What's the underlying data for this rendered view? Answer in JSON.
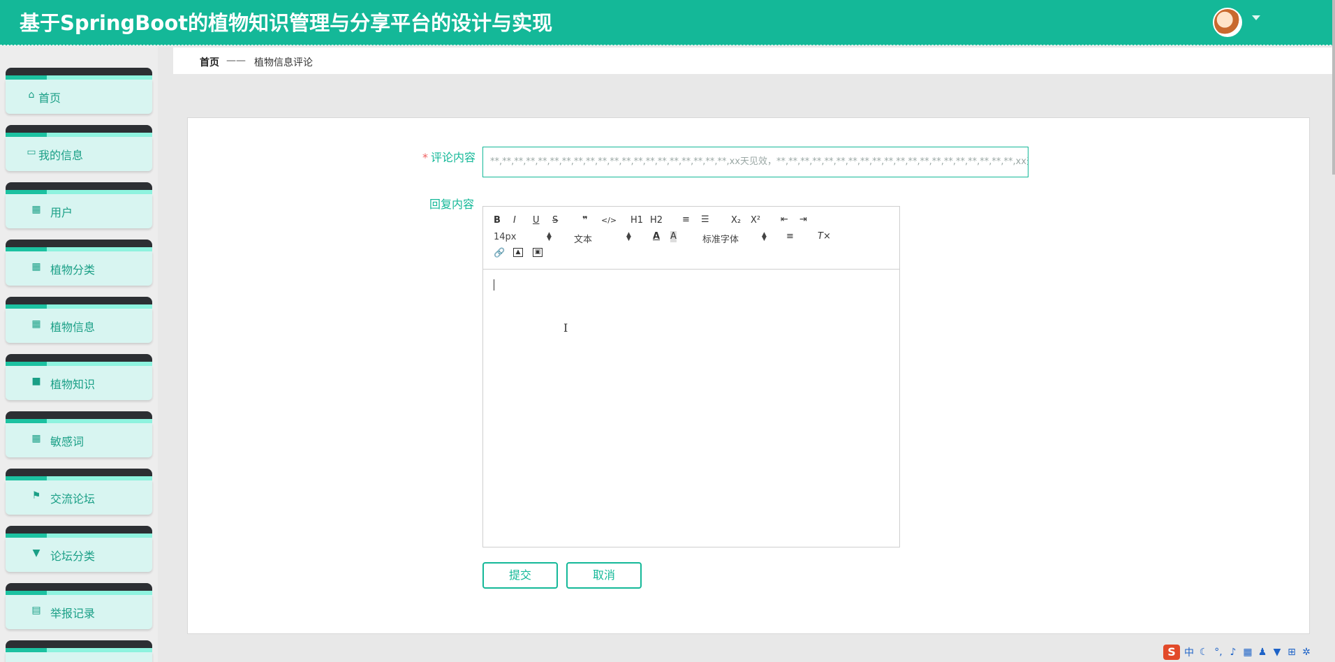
{
  "app": {
    "title": "基于SpringBoot的植物知识管理与分享平台的设计与实现"
  },
  "sidebar": {
    "items": [
      {
        "label": "首页",
        "icon": "home-icon",
        "glyph": "⌂"
      },
      {
        "label": "我的信息",
        "icon": "card-icon",
        "glyph": "▭"
      },
      {
        "label": "用户",
        "icon": "grid-icon",
        "glyph": "▦"
      },
      {
        "label": "植物分类",
        "icon": "grid-icon",
        "glyph": "▦"
      },
      {
        "label": "植物信息",
        "icon": "grid-icon",
        "glyph": "▦"
      },
      {
        "label": "植物知识",
        "icon": "briefcase-icon",
        "glyph": "■"
      },
      {
        "label": "敏感词",
        "icon": "grid-icon",
        "glyph": "▦"
      },
      {
        "label": "交流论坛",
        "icon": "flag-icon",
        "glyph": "⚑"
      },
      {
        "label": "论坛分类",
        "icon": "brush-icon",
        "glyph": "▼"
      },
      {
        "label": "举报记录",
        "icon": "clipboard-icon",
        "glyph": "▤"
      }
    ]
  },
  "breadcrumb": {
    "home": "首页",
    "separator": "——",
    "current": "植物信息评论"
  },
  "form": {
    "required_mark": "*",
    "comment_label": "评论内容",
    "comment_value": "**,**,**,**,**,**,**,**,**,**,**,**,**,**,**,**,**,**,**,**,xx天见效，**,**,**,**,**,**,**,**,**,**,**,**,**,**,**,**,**,**,**,**,xx天见你好",
    "reply_label": "回复内容",
    "submit_label": "提交",
    "cancel_label": "取消"
  },
  "editor": {
    "font_size": "14px",
    "text_type": "文本",
    "font_family": "标准字体",
    "buttons": [
      "B",
      "I",
      "U",
      "S",
      "❞",
      "</>",
      "H1",
      "H2",
      "ordered-list",
      "bullet-list",
      "X₂",
      "X²",
      "outdent",
      "indent",
      "font-color",
      "background-color",
      "align",
      "clear-format",
      "link",
      "image",
      "video"
    ]
  },
  "ime": {
    "logo": "S",
    "mode": "中"
  },
  "colors": {
    "primary": "#14b898",
    "header_bg": "#14b898",
    "sidebar_item_bg": "#d8f5f1",
    "required": "#f06262"
  }
}
